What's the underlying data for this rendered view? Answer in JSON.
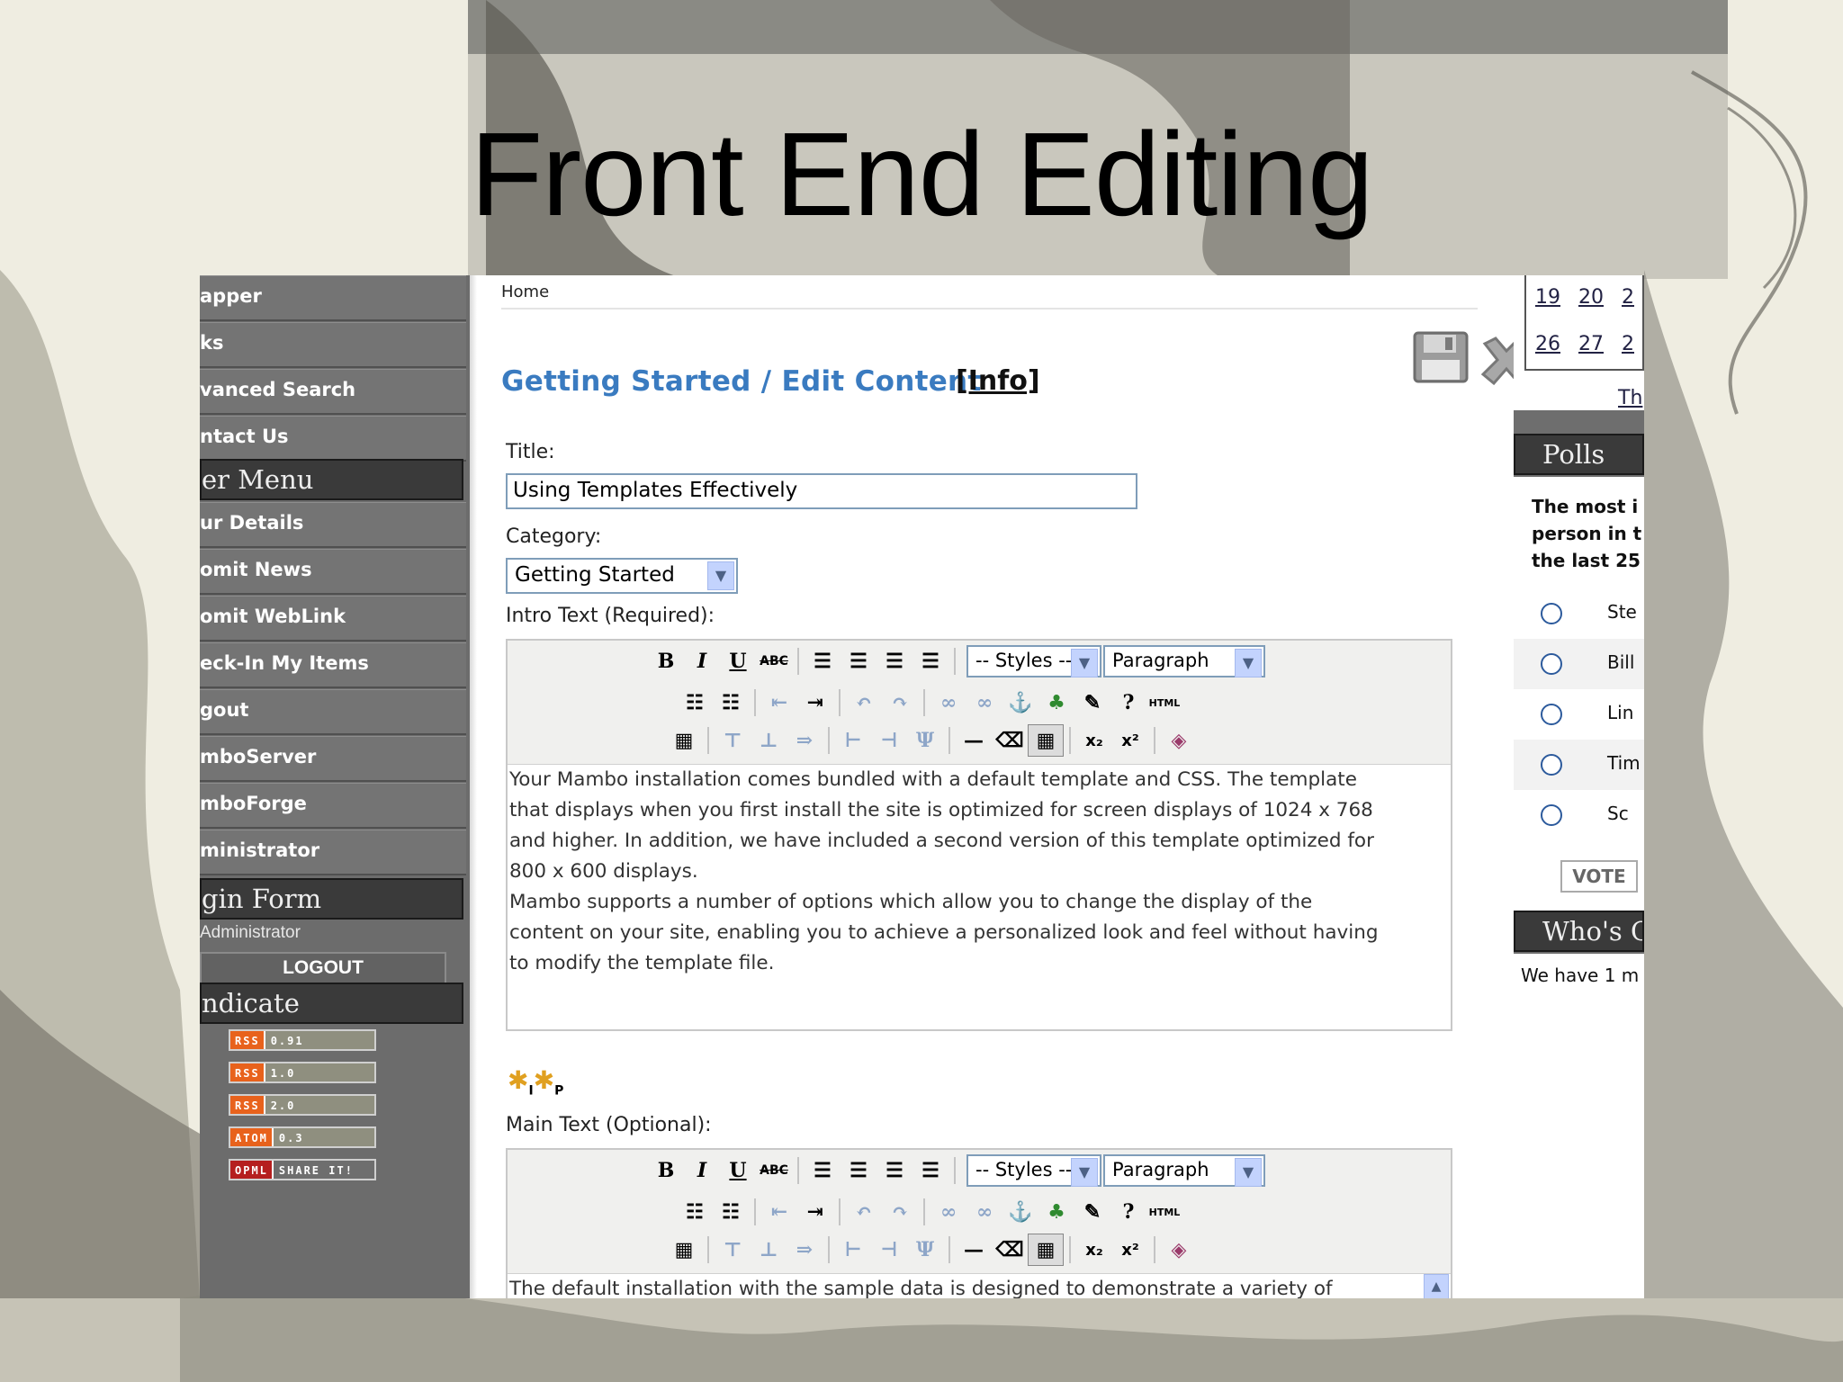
{
  "slide": {
    "title": "Front End Editing"
  },
  "left_menu": {
    "items_top": [
      "apper",
      "ks",
      "vanced Search",
      "ntact Us"
    ],
    "user_menu_header": "er Menu",
    "user_items": [
      "ur Details",
      "omit News",
      "omit WebLink",
      "eck-In My Items",
      "gout",
      "mboServer",
      "mboForge",
      "ministrator"
    ],
    "login_header": "gin Form",
    "logged_in_user": "Administrator",
    "logout_label": "LOGOUT",
    "syndicate_header": "ndicate",
    "feeds": [
      {
        "a": "RSS",
        "b": "0.91"
      },
      {
        "a": "RSS",
        "b": "1.0"
      },
      {
        "a": "RSS",
        "b": "2.0"
      },
      {
        "a": "ATOM",
        "b": "0.3"
      },
      {
        "a": "OPML",
        "b": "SHARE IT!"
      }
    ]
  },
  "main": {
    "breadcrumb": "Home",
    "page_title": "Getting Started / Edit  Content",
    "info_link": "[Info]",
    "title_label": "Title:",
    "title_value": "Using Templates Effectively",
    "category_label": "Category:",
    "category_value": "Getting Started",
    "intro_label": "Intro Text (Required):",
    "main_label": "Main Text (Optional):",
    "styles_select": "-- Styles --",
    "format_select": "Paragraph",
    "html_button": "HTML",
    "intro_lines": [
      "Your Mambo installation comes bundled with a default template and CSS. The template",
      "that displays when you first install the site is optimized for screen displays of 1024 x 768",
      "and higher. In addition, we have included a second version of this template optimized for",
      "800 x 600 displays.",
      "Mambo supports a number of options which allow you to change the display of the",
      "content on your site, enabling you to achieve a personalized look and feel without having",
      "to modify the template file."
    ],
    "main_lines": [
      "The default installation with the sample data is designed to demonstrate a variety of"
    ]
  },
  "right_sidebar": {
    "calendar": [
      [
        "19",
        "20",
        "2"
      ],
      [
        "26",
        "27",
        "2"
      ]
    ],
    "calendar_link": "Th",
    "polls_header": "Polls",
    "poll_question": [
      "The most i",
      "person in t",
      "the last 25"
    ],
    "poll_options": [
      "Ste",
      "Bill",
      "Lin",
      "Tim",
      "Sc"
    ],
    "vote_label": "VOTE",
    "whos_header": "Who's O",
    "whos_text": "We have 1 m"
  },
  "colors": {
    "menu_bg": "#747474",
    "menu_header_bg": "#3a3a3a",
    "title_blue": "#3a7bc0",
    "input_border": "#7f9db9"
  }
}
